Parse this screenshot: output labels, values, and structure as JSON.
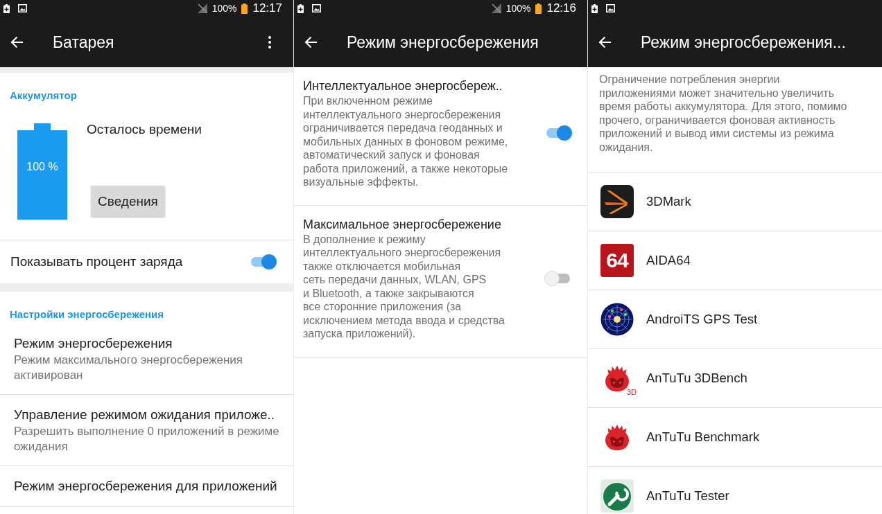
{
  "screens": [
    {
      "kind": "settings",
      "status_bar": {
        "battery": "100%",
        "time": "12:17"
      },
      "app_bar": {
        "title": "Батарея",
        "menu": true
      },
      "sections": [
        {
          "header": "Аккумулятор",
          "items": [
            {
              "kind": "battery",
              "level": 1,
              "percent": "100 %",
              "label": "Осталось времени",
              "button": "Сведения"
            },
            {
              "kind": "switch",
              "title": "Показывать процент заряда",
              "on": true
            }
          ]
        },
        {
          "header": "Настройки энергосбережения",
          "items": [
            {
              "kind": "link",
              "title": "Режим энергосбережения",
              "subtitle": "Режим максимального энергосбережения\nактивирован"
            },
            {
              "kind": "link",
              "title": "Управление режимом ожидания приложе..",
              "subtitle": "Разрешить выполнение 0 приложений в режиме\nожидания"
            },
            {
              "kind": "link",
              "title": "Режим энергосбережения для приложений"
            }
          ]
        }
      ]
    },
    {
      "kind": "modes",
      "status_bar": {
        "battery": "100%",
        "time": "12:16"
      },
      "app_bar": {
        "title": "Режим энергосбережения",
        "menu": false
      },
      "options": [
        {
          "title": "Интеллектуальное энергосбереж..",
          "description": "При включенном режиме\nинтеллектуального энергосбережения\nограничивается передача геоданных и\nмобильных данных в фоновом режиме,\nавтоматический запуск и фоновая\nработа приложений, а также некоторые\nвизуальные эффекты.",
          "on": true
        },
        {
          "title": "Максимальное энергосбережение",
          "description": "В дополнение к режиму\nинтеллектуального энергосбережения\nтакже отключается мобильная\nсеть передачи данных, WLAN, GPS\nи Bluetooth, а также закрываются\nвсе сторонние приложения (за\nисключением метода ввода и средства\nзапуска приложений).",
          "on": false
        }
      ]
    },
    {
      "kind": "apps",
      "app_bar": {
        "title": "Режим энергосбережения...",
        "menu": false
      },
      "description": "Ограничение потребления энергии\nприложениями может значительно увеличить\nвремя работы аккумулятора. Для этого, помимо\nпрочего, ограничивается фоновая активность\nприложений и вывод ими системы из режима\nожидания.",
      "apps": [
        {
          "kind": "streaks",
          "name": "3DMark"
        },
        {
          "kind": "number",
          "icon_text": "64",
          "name": "AIDA64"
        },
        {
          "kind": "radar",
          "name": "AndroiTS GPS Test"
        },
        {
          "kind": "mascot",
          "icon_text": "3D",
          "name": "AnTuTu 3DBench"
        },
        {
          "kind": "mascot",
          "name": "AnTuTu Benchmark"
        },
        {
          "kind": "wrench",
          "name": "AnTuTu Tester"
        }
      ]
    }
  ]
}
